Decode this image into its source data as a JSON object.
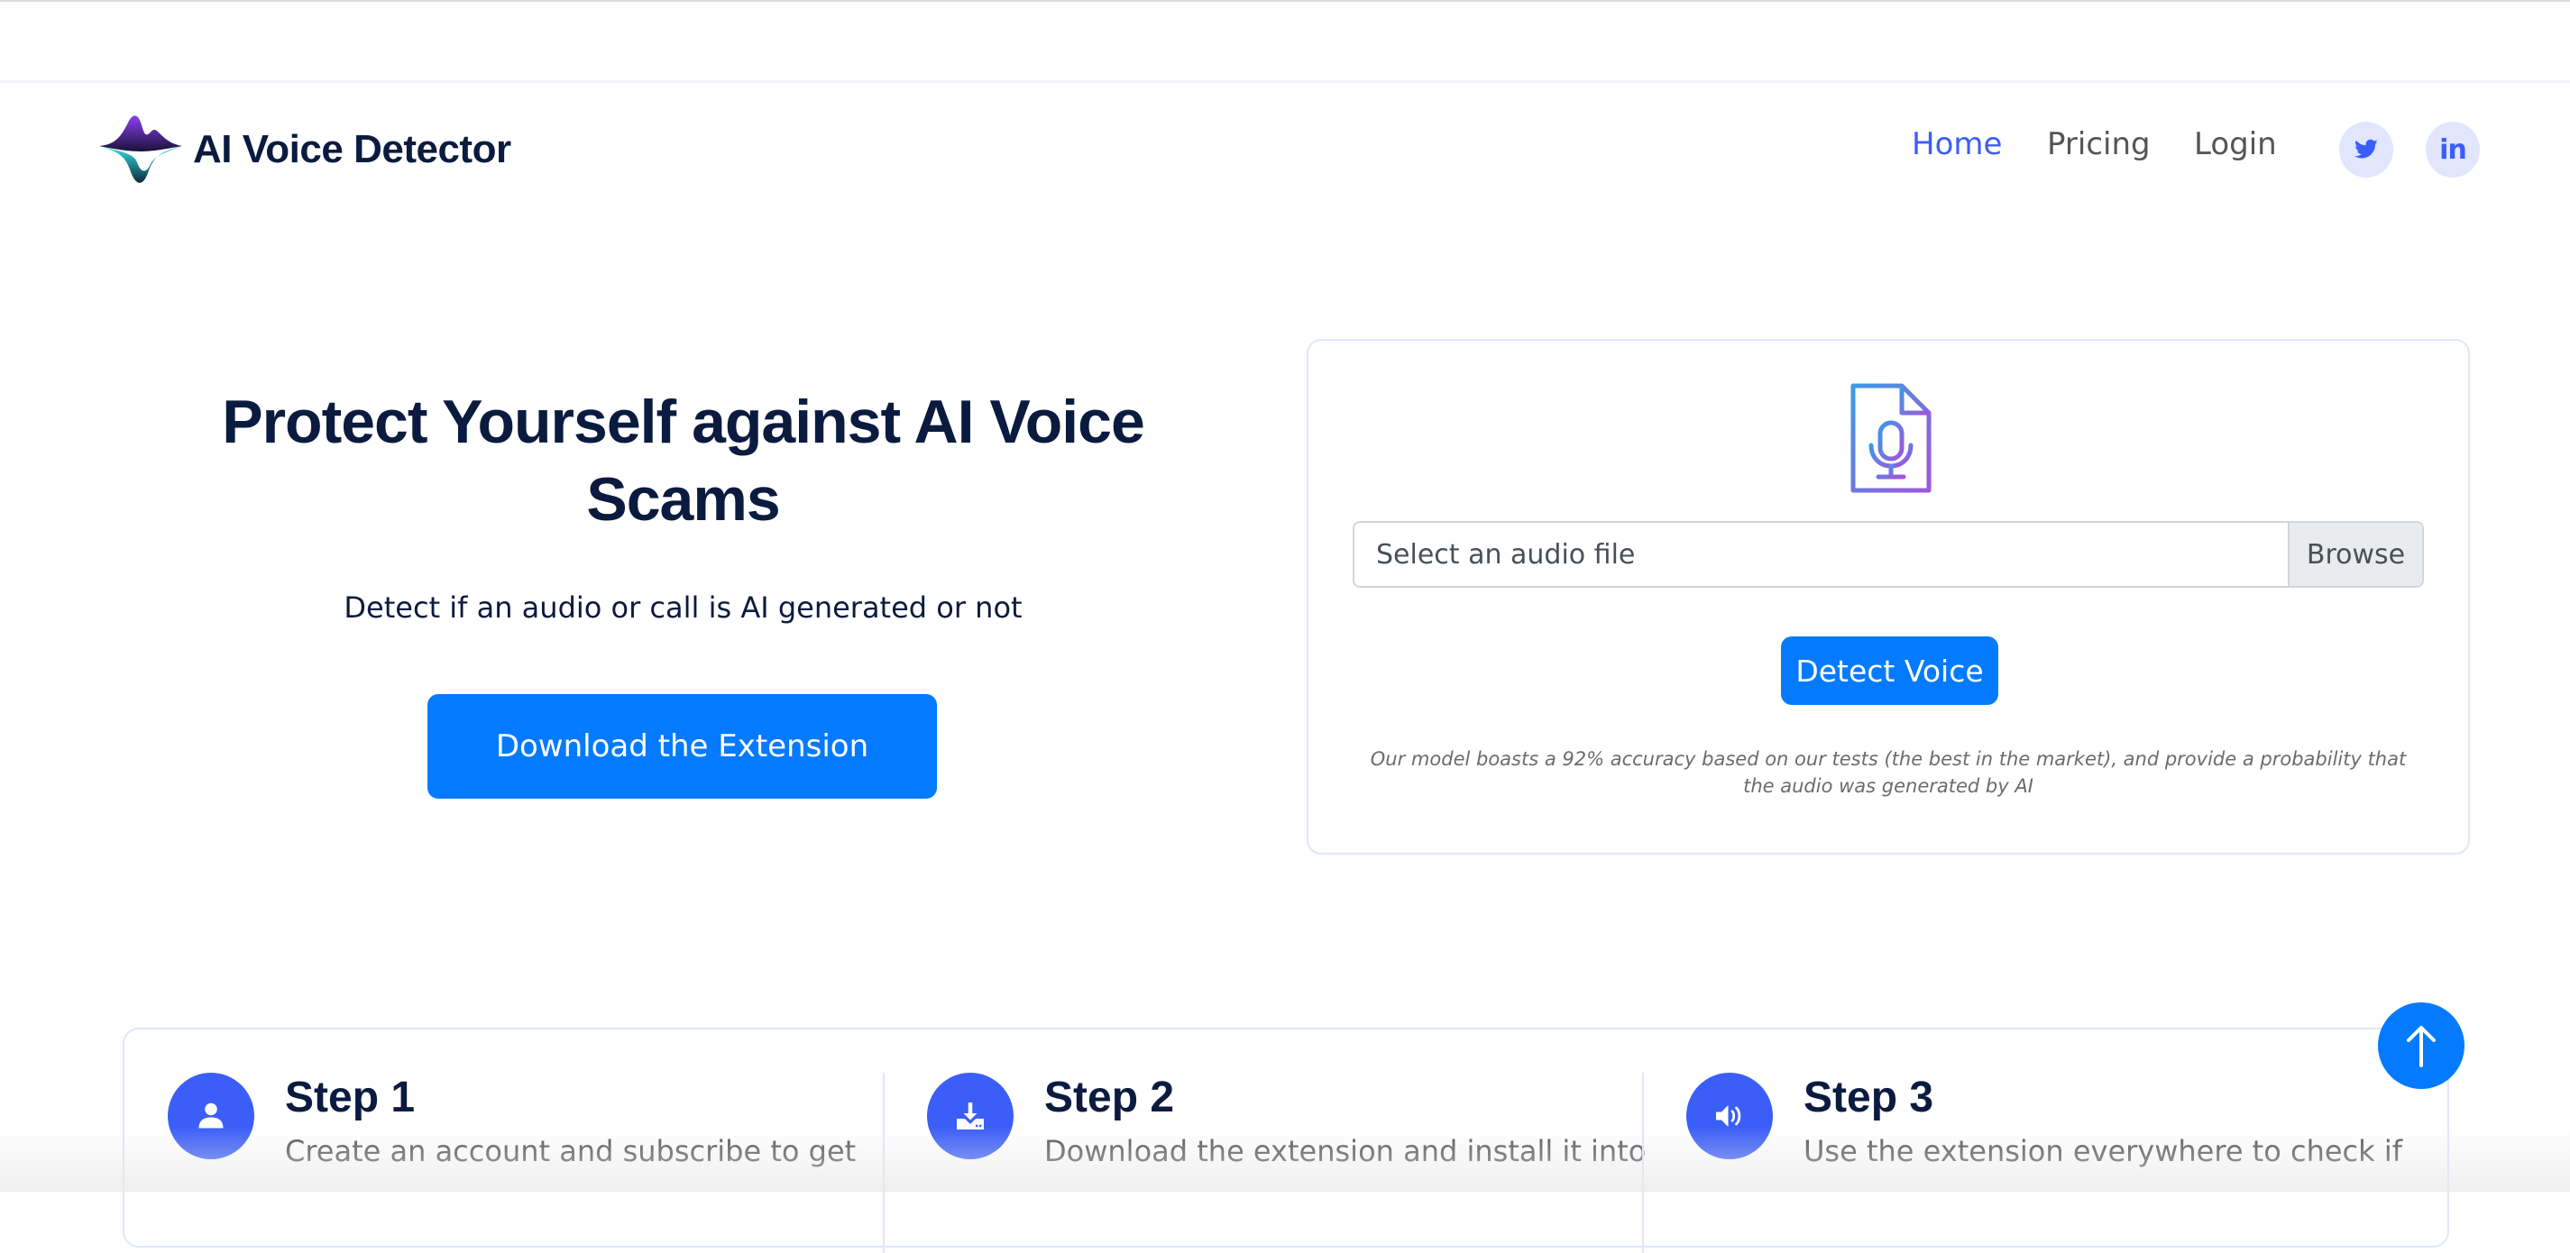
{
  "header": {
    "brand": "AI Voice Detector",
    "nav": [
      {
        "label": "Home",
        "active": true
      },
      {
        "label": "Pricing",
        "active": false
      },
      {
        "label": "Login",
        "active": false
      }
    ],
    "social": [
      {
        "name": "twitter",
        "icon": "twitter-icon"
      },
      {
        "name": "linkedin",
        "icon": "linkedin-icon",
        "glyph": "in"
      }
    ]
  },
  "hero": {
    "title": "Protect Yourself against AI Voice Scams",
    "subtitle": "Detect if an audio or call is AI generated or not",
    "cta_label": "Download the Extension"
  },
  "upload": {
    "icon": "audio-file-icon",
    "file_placeholder": "Select an audio file",
    "browse_label": "Browse",
    "detect_label": "Detect Voice",
    "disclaimer": "Our model boasts a 92% accuracy based on our tests (the best in the market), and provide a probability that the audio was generated by AI"
  },
  "steps": [
    {
      "title": "Step 1",
      "desc": "Create an account and subscribe to get",
      "icon": "user-icon"
    },
    {
      "title": "Step 2",
      "desc": "Download the extension and install it into",
      "icon": "download-icon"
    },
    {
      "title": "Step 3",
      "desc": "Use the extension everywhere to check if",
      "icon": "speaker-icon"
    }
  ],
  "colors": {
    "primary": "#047bfe",
    "accent": "#3b5ef8",
    "heading": "#0b1b3f",
    "social_bg": "#e1e6fd",
    "border": "#e0e6fb"
  }
}
